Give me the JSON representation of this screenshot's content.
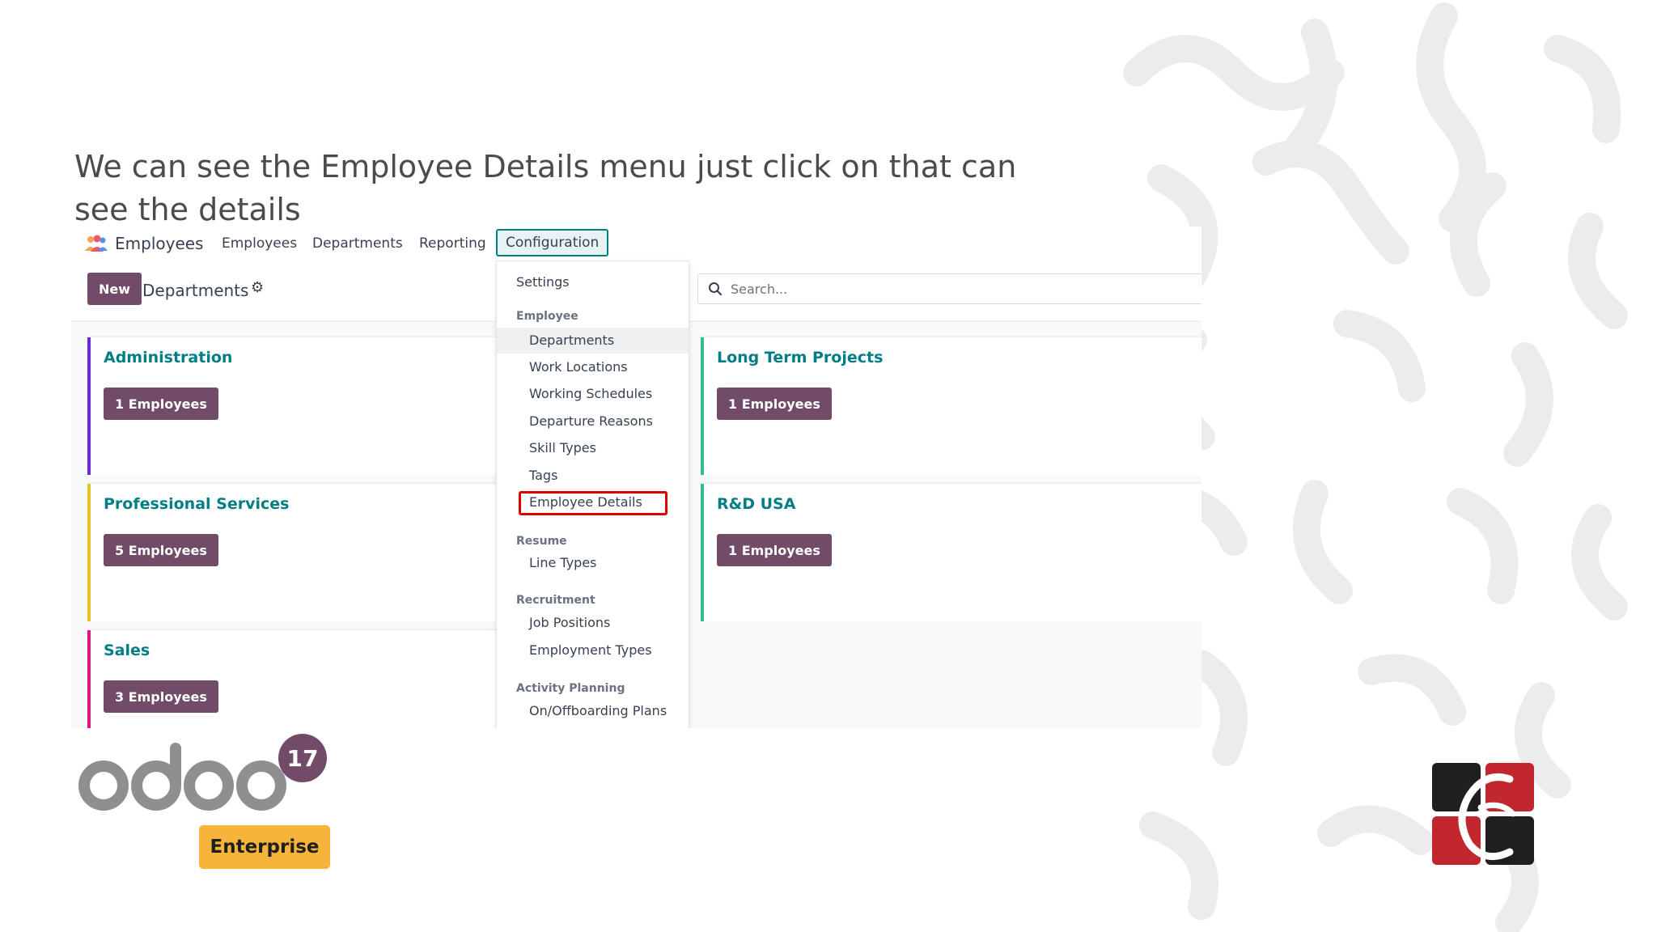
{
  "caption": "We can see the Employee Details menu just click on that can see the details",
  "navbar": {
    "app_name": "Employees",
    "links": [
      "Employees",
      "Departments",
      "Reporting"
    ],
    "active_menu": "Configuration"
  },
  "control_panel": {
    "new_label": "New",
    "title": "Departments",
    "search_placeholder": "Search..."
  },
  "departments": [
    {
      "name": "Administration",
      "count_label": "1 Employees",
      "color": "#6d28d9"
    },
    {
      "name": "Long Term Projects",
      "count_label": "1 Employees",
      "color": "#2fbf8f"
    },
    {
      "name": "Professional Services",
      "count_label": "5 Employees",
      "color": "#e3c624"
    },
    {
      "name": "R&D USA",
      "count_label": "1 Employees",
      "color": "#2fbf8f"
    },
    {
      "name": "Sales",
      "count_label": "3 Employees",
      "color": "#e0177a"
    }
  ],
  "config_menu": {
    "settings": "Settings",
    "employee_header": "Employee",
    "employee_items": [
      "Departments",
      "Work Locations",
      "Working Schedules",
      "Departure Reasons",
      "Skill Types",
      "Tags",
      "Employee Details"
    ],
    "resume_header": "Resume",
    "resume_items": [
      "Line Types"
    ],
    "recruitment_header": "Recruitment",
    "recruitment_items": [
      "Job Positions",
      "Employment Types"
    ],
    "activity_header": "Activity Planning",
    "activity_items": [
      "On/Offboarding Plans"
    ]
  },
  "branding": {
    "odoo_wordmark": "odoo",
    "version": "17",
    "edition": "Enterprise"
  },
  "colors": {
    "primary": "#714b67",
    "teal": "#017e84",
    "highlight": "#e00000",
    "badge": "#f6b43b"
  }
}
